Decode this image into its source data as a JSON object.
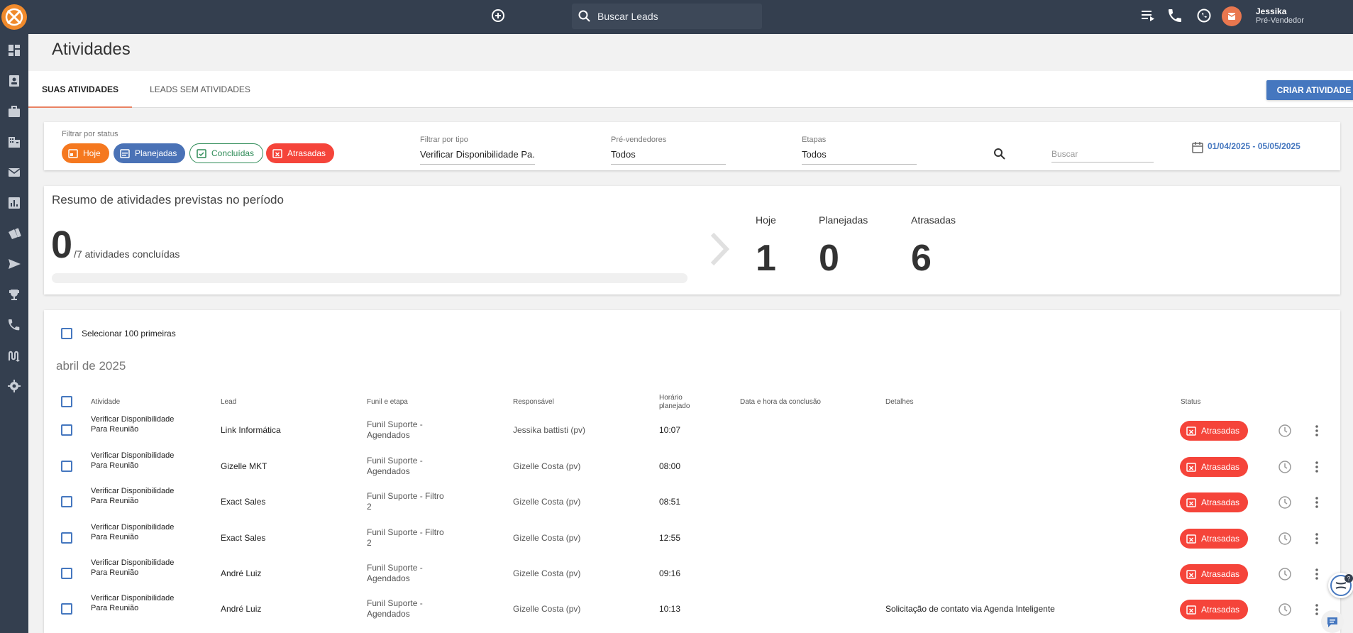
{
  "header": {
    "search_placeholder": "Buscar Leads",
    "user_name": "Jessika",
    "user_role": "Pré-Vendedor",
    "icons": [
      "add-circle-icon",
      "search-icon",
      "queue-icon",
      "phone-icon",
      "whatsapp-icon"
    ]
  },
  "sidebar": {
    "items": [
      "dashboard-icon",
      "contacts-icon",
      "briefcase-icon",
      "building-icon",
      "mail-icon",
      "chart-icon",
      "megaphone-icon",
      "send-icon",
      "trophy-icon",
      "phone-icon",
      "route-icon",
      "settings-icon"
    ]
  },
  "page": {
    "title": "Atividades"
  },
  "tabs": [
    {
      "label": "SUAS ATIVIDADES",
      "active": true
    },
    {
      "label": "LEADS SEM ATIVIDADES",
      "active": false
    }
  ],
  "create_button": "CRIAR ATIVIDADE",
  "filters": {
    "status_label": "Filtrar por status",
    "chips": [
      {
        "label": "Hoje",
        "color": "#f5781f",
        "style": "filled"
      },
      {
        "label": "Planejadas",
        "color": "#4a72b6",
        "style": "filled"
      },
      {
        "label": "Concluídas",
        "color": "#2e8b57",
        "style": "outlined"
      },
      {
        "label": "Atrasadas",
        "color": "#f5443a",
        "style": "filled"
      }
    ],
    "type_label": "Filtrar por tipo",
    "type_value": "Verificar Disponibilidade Pa...",
    "presales_label": "Pré-vendedores",
    "presales_value": "Todos",
    "stages_label": "Etapas",
    "stages_value": "Todos",
    "search_placeholder": "Buscar",
    "date_range": "01/04/2025 - 05/05/2025"
  },
  "summary": {
    "title": "Resumo de atividades previstas no período",
    "completed": "0",
    "completed_text": "/7 atividades concluídas",
    "progress": 0,
    "stats": [
      {
        "label": "Hoje",
        "value": "1"
      },
      {
        "label": "Planejadas",
        "value": "0"
      },
      {
        "label": "Atrasadas",
        "value": "6"
      }
    ]
  },
  "list": {
    "select_all_label": "Selecionar 100 primeiras",
    "month": "abril de 2025",
    "columns": {
      "activity": "Atividade",
      "lead": "Lead",
      "funnel": "Funil e etapa",
      "responsible": "Responsável",
      "time_line1": "Horário",
      "time_line2": "planejado",
      "completion": "Data e hora da conclusão",
      "details": "Detalhes",
      "status": "Status"
    },
    "rows": [
      {
        "activity": "Verificar Disponibilidade Para Reunião",
        "lead": "Link Informática",
        "funnel": "Funil Suporte - Agendados",
        "responsible": "Jessika battisti (pv)",
        "time": "10:07",
        "completion": "",
        "details": "",
        "status": "Atrasadas"
      },
      {
        "activity": "Verificar Disponibilidade Para Reunião",
        "lead": "Gizelle MKT",
        "funnel": "Funil Suporte - Agendados",
        "responsible": "Gizelle Costa (pv)",
        "time": "08:00",
        "completion": "",
        "details": "",
        "status": "Atrasadas"
      },
      {
        "activity": "Verificar Disponibilidade Para Reunião",
        "lead": "Exact Sales",
        "funnel": "Funil Suporte - Filtro 2",
        "responsible": "Gizelle Costa (pv)",
        "time": "08:51",
        "completion": "",
        "details": "",
        "status": "Atrasadas"
      },
      {
        "activity": "Verificar Disponibilidade Para Reunião",
        "lead": "Exact Sales",
        "funnel": "Funil Suporte - Filtro 2",
        "responsible": "Gizelle Costa (pv)",
        "time": "12:55",
        "completion": "",
        "details": "",
        "status": "Atrasadas"
      },
      {
        "activity": "Verificar Disponibilidade Para Reunião",
        "lead": "André Luiz",
        "funnel": "Funil Suporte - Agendados",
        "responsible": "Gizelle Costa (pv)",
        "time": "09:16",
        "completion": "",
        "details": "",
        "status": "Atrasadas"
      },
      {
        "activity": "Verificar Disponibilidade Para Reunião",
        "lead": "André Luiz",
        "funnel": "Funil Suporte - Agendados",
        "responsible": "Gizelle Costa (pv)",
        "time": "10:13",
        "completion": "",
        "details": "Solicitação de contato via Agenda Inteligente",
        "status": "Atrasadas"
      }
    ]
  },
  "colors": {
    "topbar": "#343f4f",
    "accent": "#4577bf",
    "late": "#f5443a",
    "today": "#f5781f",
    "tab_underline": "#e98263"
  }
}
